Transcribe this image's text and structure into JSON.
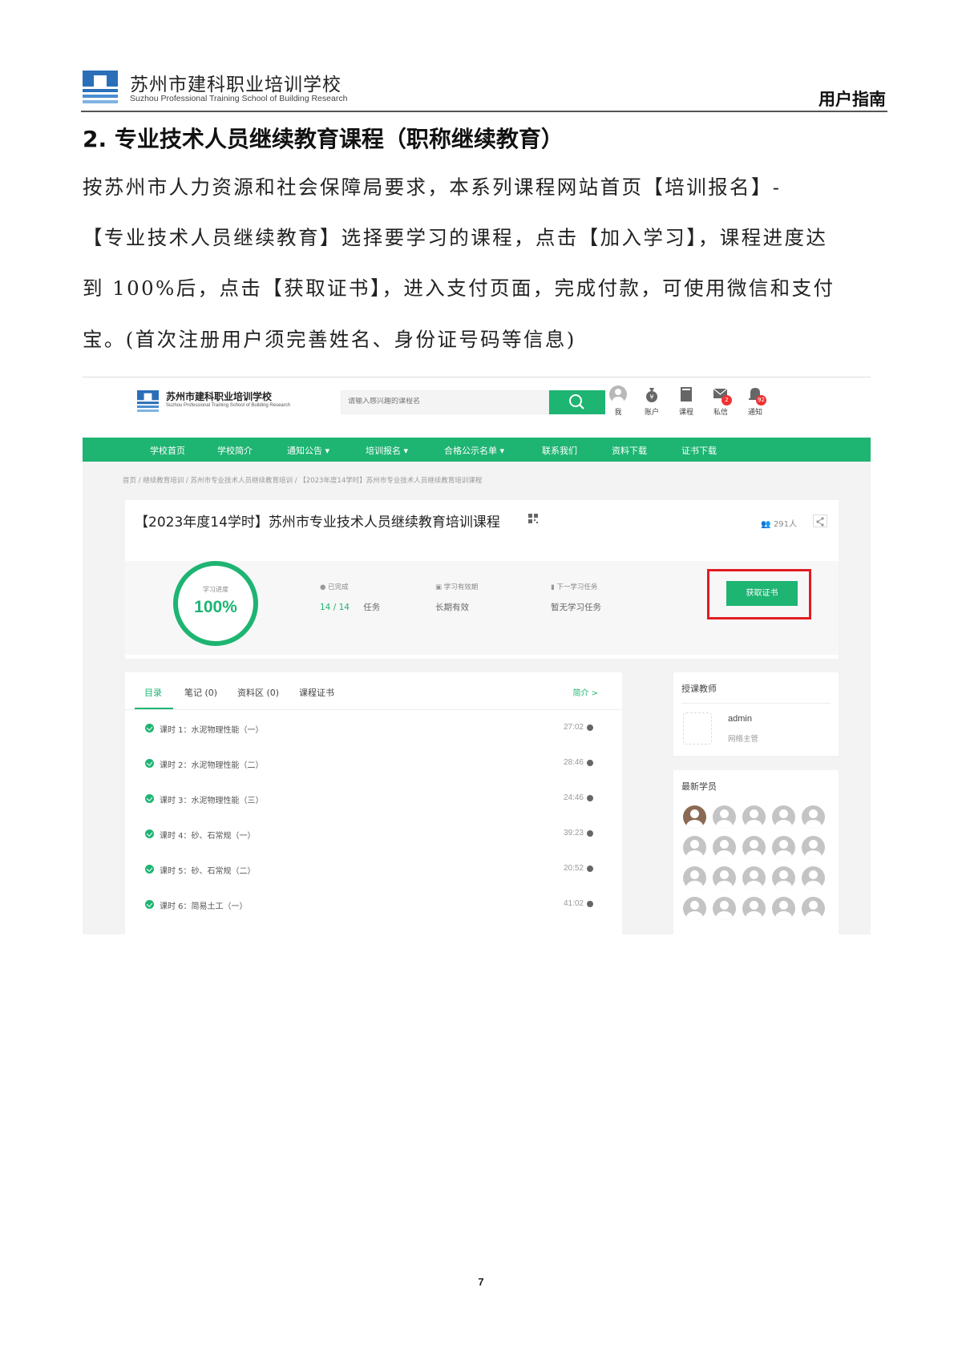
{
  "header": {
    "school_name_cn": "苏州市建科职业培训学校",
    "school_name_en": "Suzhou Professional Training School of Building Research",
    "guide_label": "用户指南"
  },
  "section": {
    "title": "2. 专业技术人员继续教育课程（职称继续教育）",
    "paragraph_lines": [
      "按苏州市人力资源和社会保障局要求，本系列课程网站首页【培训报名】-",
      "【专业技术人员继续教育】选择要学习的课程，点击【加入学习】，课程进度达",
      "到 100%后，点击【获取证书】，进入支付页面，完成付款，可使用微信和支付",
      "宝。(首次注册用户须完善姓名、身份证号码等信息)"
    ]
  },
  "screenshot": {
    "site_name": "苏州市建科职业培训学校",
    "site_subtitle": "Suzhou Professional Training School of Building Research",
    "search_placeholder": "请输入感兴趣的课程名",
    "toolbar": [
      {
        "label": "我",
        "icon": "user-icon"
      },
      {
        "label": "账户",
        "icon": "money-bag-icon"
      },
      {
        "label": "课程",
        "icon": "book-icon"
      },
      {
        "label": "私信",
        "icon": "mail-icon",
        "badge": "2"
      },
      {
        "label": "通知",
        "icon": "bell-icon",
        "badge": "92"
      }
    ],
    "nav": [
      "学校首页",
      "学校简介",
      "通知公告 ▾",
      "培训报名 ▾",
      "合格公示名单 ▾",
      "联系我们",
      "资料下载",
      "证书下载"
    ],
    "breadcrumb": "首页  /  继续教育培训  /  苏州市专业技术人员继续教育培训  /  【2023年度14学时】苏州市专业技术人员继续教育培训课程",
    "course_title": "【2023年度14学时】苏州市专业技术人员继续教育培训课程",
    "learner_count": "291人",
    "progress_label": "学习进度",
    "progress_value": "100%",
    "progress_fraction": 1.0,
    "completed_label": "已完成",
    "completed_value": "14 / 14",
    "completed_unit": "任务",
    "validity_label": "学习有效期",
    "validity_value": "长期有效",
    "next_task_label": "下一学习任务",
    "next_task_value": "暂无学习任务",
    "certificate_button": "获取证书",
    "tabs": [
      "目录",
      "笔记 (0)",
      "资料区 (0)",
      "课程证书"
    ],
    "intro_link": "简介 >",
    "lessons": [
      {
        "name": "课时 1：水泥物理性能（一）",
        "duration": "27:02"
      },
      {
        "name": "课时 2：水泥物理性能（二）",
        "duration": "28:46"
      },
      {
        "name": "课时 3：水泥物理性能（三）",
        "duration": "24:46"
      },
      {
        "name": "课时 4：砂、石常规（一）",
        "duration": "39:23"
      },
      {
        "name": "课时 5：砂、石常规（二）",
        "duration": "20:52"
      },
      {
        "name": "课时 6：简易土工（一）",
        "duration": "41:02"
      }
    ],
    "teacher_title": "授课教师",
    "teacher_name": "admin",
    "teacher_role": "网络主管",
    "students_title": "最新学员",
    "colors": {
      "accent": "#1eb472",
      "highlight": "#e21b23"
    }
  },
  "page_number": "7"
}
